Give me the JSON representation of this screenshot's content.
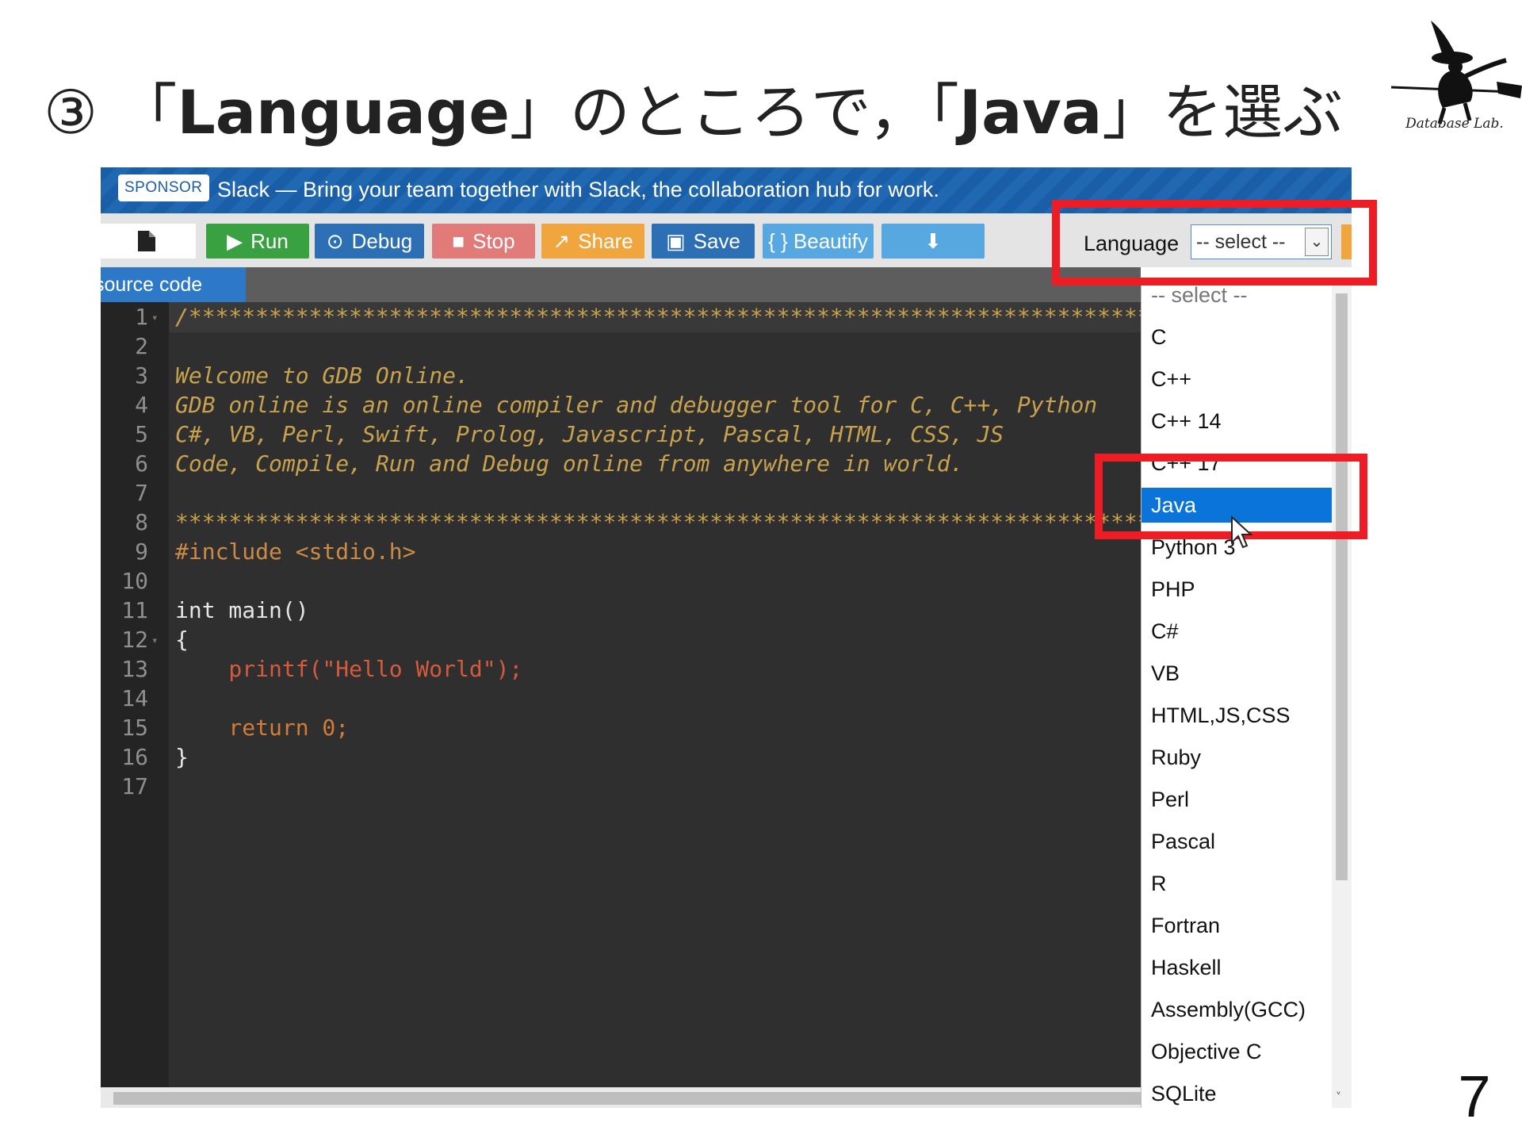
{
  "slide": {
    "number_mark": "③",
    "title_open": "「",
    "title_term1": "Language",
    "title_mid": "」のところで，「",
    "title_term2": "Java",
    "title_end": "」を選ぶ",
    "logo_text": "Database Lab.",
    "page_number": "7"
  },
  "sponsor": {
    "badge": "SPONSOR",
    "text": "Slack — Bring your team together with Slack, the collaboration hub for work."
  },
  "toolbar": {
    "run": "Run",
    "debug": "Debug",
    "stop": "Stop",
    "share": "Share",
    "save": "Save",
    "beautify": "{ } Beautify",
    "language_label": "Language",
    "language_value": "-- select --"
  },
  "editor": {
    "tab": "source code",
    "lines": [
      {
        "n": "1",
        "t": "/*******************************************************************************"
      },
      {
        "n": "2",
        "t": ""
      },
      {
        "n": "3",
        "t": "Welcome to GDB Online."
      },
      {
        "n": "4",
        "t": "GDB online is an online compiler and debugger tool for C, C++, Python"
      },
      {
        "n": "5",
        "t": "C#, VB, Perl, Swift, Prolog, Javascript, Pascal, HTML, CSS, JS"
      },
      {
        "n": "6",
        "t": "Code, Compile, Run and Debug online from anywhere in world."
      },
      {
        "n": "7",
        "t": ""
      },
      {
        "n": "8",
        "t": "*******************************************************************************"
      },
      {
        "n": "9",
        "t": "#include <stdio.h>"
      },
      {
        "n": "10",
        "t": ""
      },
      {
        "n": "11",
        "t": "int main()"
      },
      {
        "n": "12",
        "t": "{"
      },
      {
        "n": "13",
        "t": "    printf(\"Hello World\");"
      },
      {
        "n": "14",
        "t": ""
      },
      {
        "n": "15",
        "t": "    return 0;"
      },
      {
        "n": "16",
        "t": "}"
      },
      {
        "n": "17",
        "t": ""
      }
    ]
  },
  "language_dropdown": {
    "options": [
      "-- select --",
      "C",
      "C++",
      "C++ 14",
      "C++ 17",
      "Java",
      "Python 3",
      "PHP",
      "C#",
      "VB",
      "HTML,JS,CSS",
      "Ruby",
      "Perl",
      "Pascal",
      "R",
      "Fortran",
      "Haskell",
      "Assembly(GCC)",
      "Objective C",
      "SQLite"
    ],
    "selected": "Java"
  },
  "colors": {
    "highlight_box": "#ee1c25",
    "selected_option": "#0a74da",
    "editor_bg": "#2f2f2f",
    "comment": "#c8a24e"
  }
}
